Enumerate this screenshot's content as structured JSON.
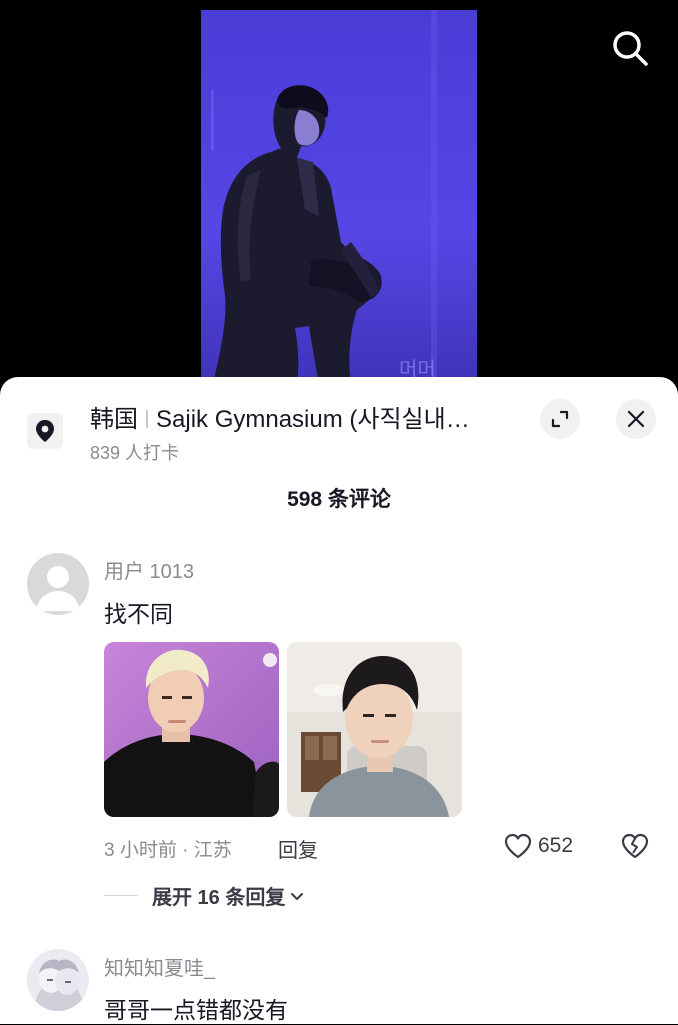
{
  "video": {
    "watermark": "머머"
  },
  "location": {
    "country": "韩国",
    "venue": "Sajik Gymnasium (사직실내…",
    "checkins": "839 人打卡"
  },
  "comments_header": "598 条评论",
  "comments": [
    {
      "username": "用户 1013",
      "text": "找不同",
      "time_location": "3 小时前 · 江苏",
      "reply_label": "回复",
      "likes": "652",
      "expand_replies": "展开 16 条回复"
    },
    {
      "username": "知知知夏哇_",
      "text": "哥哥一点错都没有"
    }
  ],
  "colors": {
    "video_bg": "#4d3fe0",
    "sheet_bg": "#ffffff",
    "text_primary": "#161823",
    "text_secondary": "#8a8b91"
  },
  "icons": {
    "search": "search-icon",
    "location": "location-pin-icon",
    "expand": "expand-icon",
    "close": "close-icon",
    "like": "heart-icon",
    "dislike": "broken-heart-icon",
    "chevron": "chevron-down-icon"
  }
}
